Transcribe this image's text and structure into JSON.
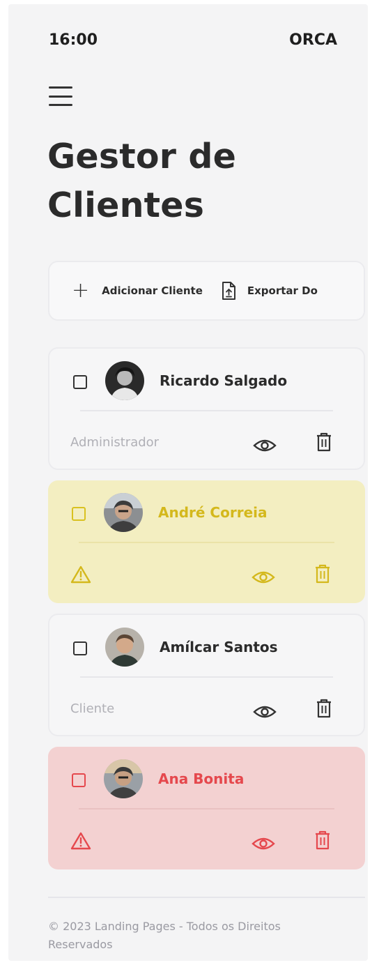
{
  "status_bar": {
    "time": "16:00",
    "carrier": "ORCA"
  },
  "page": {
    "title": "Gestor de Clientes"
  },
  "toolbar": {
    "add_label": "Adicionar Cliente",
    "export_label": "Exportar Do"
  },
  "clients": [
    {
      "name": "Ricardo Salgado",
      "role": "Administrador",
      "status": "normal",
      "avatar_icon": "user-avatar"
    },
    {
      "name": "André Correia",
      "role": "",
      "status": "warning",
      "avatar_icon": "user-avatar"
    },
    {
      "name": "Amílcar Santos",
      "role": "Cliente",
      "status": "normal",
      "avatar_icon": "user-avatar"
    },
    {
      "name": "Ana Bonita",
      "role": "",
      "status": "danger",
      "avatar_icon": "user-avatar"
    }
  ],
  "colors": {
    "warning_bg": "#f3eec1",
    "warning_fg": "#d4b81c",
    "danger_bg": "#f3d1d1",
    "danger_fg": "#e5484d",
    "normal_icon": "#333333"
  },
  "footer": {
    "copyright": "© 2023 Landing Pages - Todos os Direitos Reservados"
  }
}
